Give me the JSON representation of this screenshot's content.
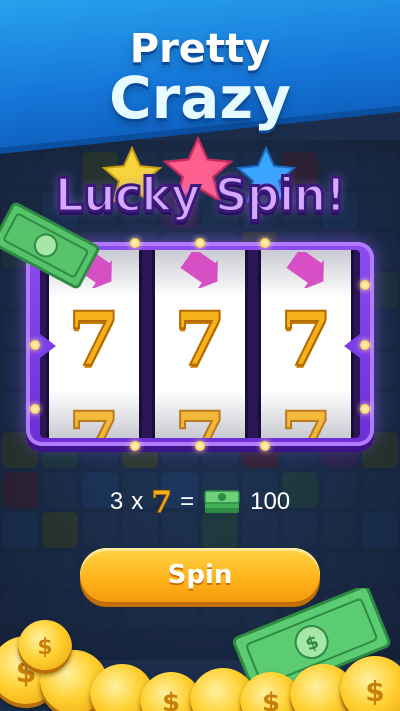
{
  "banner": {
    "line1": "Pretty",
    "line2": "Crazy",
    "color": "#1a8de6"
  },
  "lucky_spin": {
    "title": "Lucky Spin!",
    "star_colors": [
      "#f3d33a",
      "#ff5f8f",
      "#3aa6ff"
    ]
  },
  "slot_machine": {
    "reels": [
      {
        "top": "arrow",
        "middle": "7",
        "bottom": "7"
      },
      {
        "top": "arrow",
        "middle": "7",
        "bottom": "7"
      },
      {
        "top": "arrow",
        "middle": "7",
        "bottom": "7"
      }
    ],
    "frame_color": "#7b3ff0"
  },
  "payout": {
    "count": "3",
    "times": "x",
    "symbol": "7",
    "equals": "=",
    "reward_icon": "cash-stack-icon",
    "amount": "100"
  },
  "spin_button": {
    "label": "Spin",
    "color": "#ffb21a"
  },
  "decor": {
    "icons": [
      "dollar-bill-icon",
      "gold-coin-icon",
      "star-icon",
      "arrow-icon"
    ]
  }
}
